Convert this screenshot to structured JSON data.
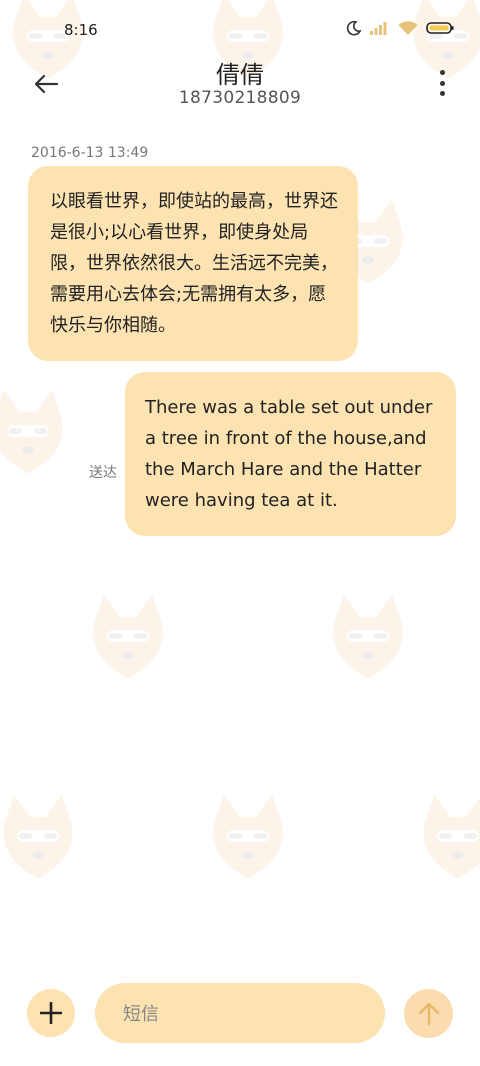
{
  "status_bar": {
    "time": "8:16",
    "icons": [
      "moon-icon",
      "signal-icon",
      "wifi-icon",
      "battery-icon"
    ]
  },
  "header": {
    "title": "倩倩",
    "subtitle": "18730218809"
  },
  "messages": [
    {
      "direction": "incoming",
      "timestamp": "2016-6-13 13:49",
      "text": "以眼看世界，即使站的最高，世界还是很小;以心看世界，即使身处局限，世界依然很大。生活远不完美，需要用心去体会;无需拥有太多，愿快乐与你相随。"
    },
    {
      "direction": "outgoing",
      "status": "送达",
      "text": "There was a table set out under a tree in front of the house,and the March Hare and the Hatter were having tea at it."
    }
  ],
  "compose": {
    "placeholder": "短信"
  },
  "colors": {
    "bubble": "#fde3b2",
    "accent": "#f6c66f"
  }
}
